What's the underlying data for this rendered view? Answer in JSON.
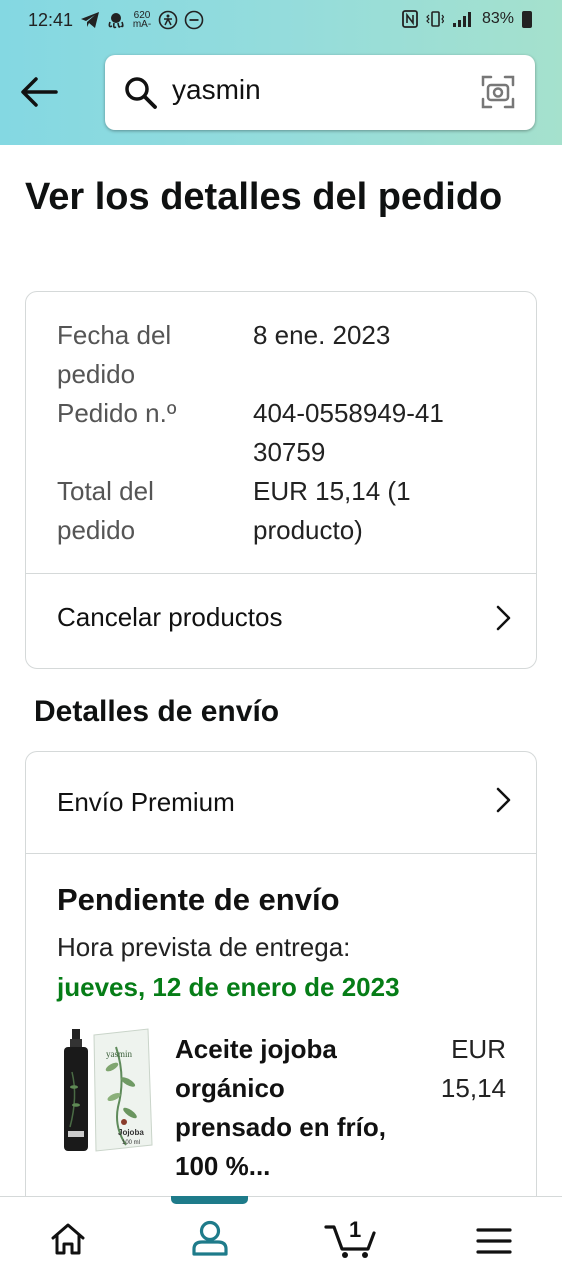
{
  "status": {
    "time": "12:41",
    "ma_top": "620",
    "ma_bottom": "mA-",
    "battery": "83%"
  },
  "search": {
    "query": "yasmin"
  },
  "page": {
    "title": "Ver los detalles del pedido"
  },
  "order": {
    "date_label": "Fecha del pedido",
    "date_value": "8 ene. 2023",
    "number_label": "Pedido n.º",
    "number_value": "404-0558949-4130759",
    "total_label": "Total del pedido",
    "total_value": "EUR 15,14 (1 producto)",
    "cancel_label": "Cancelar productos"
  },
  "shipping": {
    "section_title": "Detalles de envío",
    "method": "Envío Premium",
    "status_title": "Pendiente de envío",
    "eta_label": "Hora prevista de entrega:",
    "eta_date": "jueves, 12 de enero de 2023",
    "product": {
      "name": "Aceite jojoba orgánico prensado en frío, 100 %...",
      "price": "EUR 15,14",
      "brand": "yasmin",
      "img_label": "Jojoba",
      "img_size": "100 ml"
    }
  },
  "nav": {
    "cart_count": "1"
  },
  "colors": {
    "accent": "#1e7b8a",
    "green": "#067d17"
  }
}
